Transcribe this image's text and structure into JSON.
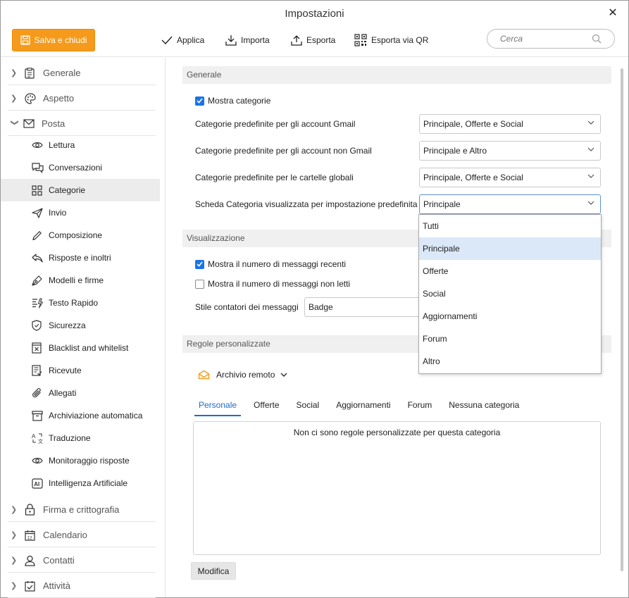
{
  "window": {
    "title": "Impostazioni"
  },
  "toolbar": {
    "save_label": "Salva e chiudi",
    "apply_label": "Applica",
    "import_label": "Importa",
    "export_label": "Esporta",
    "export_qr_label": "Esporta via QR",
    "search_placeholder": "Cerca"
  },
  "sidebar": {
    "sections": {
      "generale": "Generale",
      "aspetto": "Aspetto",
      "posta": "Posta",
      "firma": "Firma e crittografia",
      "calendario": "Calendario",
      "contatti": "Contatti",
      "attivita": "Attività"
    },
    "posta_items": [
      {
        "label": "Lettura",
        "icon": "eye-icon"
      },
      {
        "label": "Conversazioni",
        "icon": "chat-icon"
      },
      {
        "label": "Categorie",
        "icon": "grid-icon",
        "active": true
      },
      {
        "label": "Invio",
        "icon": "send-icon"
      },
      {
        "label": "Composizione",
        "icon": "pencil-icon"
      },
      {
        "label": "Risposte e inoltri",
        "icon": "reply-icon"
      },
      {
        "label": "Modelli e firme",
        "icon": "pen-nib-icon"
      },
      {
        "label": "Testo Rapido",
        "icon": "quick-text-icon"
      },
      {
        "label": "Sicurezza",
        "icon": "shield-icon"
      },
      {
        "label": "Blacklist and whitelist",
        "icon": "blacklist-icon"
      },
      {
        "label": "Ricevute",
        "icon": "receipt-icon"
      },
      {
        "label": "Allegati",
        "icon": "paperclip-icon"
      },
      {
        "label": "Archiviazione automatica",
        "icon": "archive-icon"
      },
      {
        "label": "Traduzione",
        "icon": "translate-icon"
      },
      {
        "label": "Monitoraggio risposte",
        "icon": "eye-icon"
      },
      {
        "label": "Intelligenza Artificiale",
        "icon": "ai-icon"
      }
    ]
  },
  "main": {
    "generale": {
      "header": "Generale",
      "show_categories_label": "Mostra categorie",
      "show_categories_checked": true,
      "gmail_label": "Categorie predefinite per gli account Gmail",
      "gmail_value": "Principale, Offerte e Social",
      "nongmail_label": "Categorie predefinite per gli account non Gmail",
      "nongmail_value": "Principale e Altro",
      "global_label": "Categorie predefinite per le cartelle globali",
      "global_value": "Principale, Offerte e Social",
      "default_tab_label": "Scheda Categoria visualizzata per impostazione predefinita",
      "default_tab_value": "Principale",
      "default_tab_options": [
        "Tutti",
        "Principale",
        "Offerte",
        "Social",
        "Aggiornamenti",
        "Forum",
        "Altro"
      ],
      "default_tab_selected_index": 1
    },
    "visualizzazione": {
      "header": "Visualizzazione",
      "recent_label": "Mostra il numero di messaggi recenti",
      "recent_checked": true,
      "unread_label": "Mostra il numero di messaggi non letti",
      "unread_checked": false,
      "counter_style_label": "Stile contatori dei messaggi",
      "counter_style_value": "Badge"
    },
    "regole": {
      "header": "Regole personalizzate",
      "account_label": "Archivio remoto",
      "tabs": [
        "Personale",
        "Offerte",
        "Social",
        "Aggiornamenti",
        "Forum",
        "Nessuna categoria"
      ],
      "active_tab": 0,
      "empty_text": "Non ci sono regole personalizzate per questa categoria",
      "edit_button": "Modifica"
    }
  },
  "colors": {
    "accent": "#f59a1b",
    "link": "#1f6bc9",
    "checkbox": "#1a73e8",
    "selected_row": "#dbe8f8"
  }
}
